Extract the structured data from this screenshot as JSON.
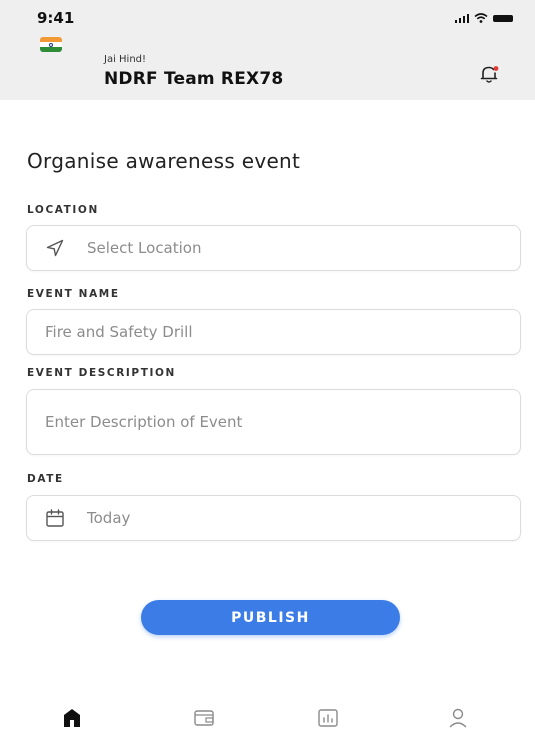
{
  "status_bar": {
    "time": "9:41"
  },
  "header": {
    "greeting": "Jai Hind!",
    "team_name": "NDRF Team REX78"
  },
  "colors": {
    "accent": "#3b7ce6",
    "flag_saffron": "#f29a36",
    "flag_white": "#ffffff",
    "flag_green": "#2f8d3a",
    "notification_dot": "#e53935"
  },
  "icons": {
    "flag": "india-flag-icon",
    "notifications": "bell-icon",
    "location": "navigation-arrow-icon",
    "date": "calendar-icon"
  },
  "form": {
    "title": "Organise awareness event",
    "location": {
      "label": "LOCATION",
      "placeholder": "Select Location"
    },
    "event_name": {
      "label": "EVENT NAME",
      "placeholder": "Fire and Safety Drill"
    },
    "event_description": {
      "label": "EVENT DESCRIPTION",
      "placeholder": "Enter Description of Event"
    },
    "date": {
      "label": "DATE",
      "placeholder": "Today"
    },
    "publish_label": "PUBLISH"
  },
  "tab_bar": {
    "tabs": [
      {
        "icon": "home-icon",
        "active": true
      },
      {
        "icon": "wallet-icon",
        "active": false
      },
      {
        "icon": "stats-icon",
        "active": false
      },
      {
        "icon": "profile-icon",
        "active": false
      }
    ]
  }
}
